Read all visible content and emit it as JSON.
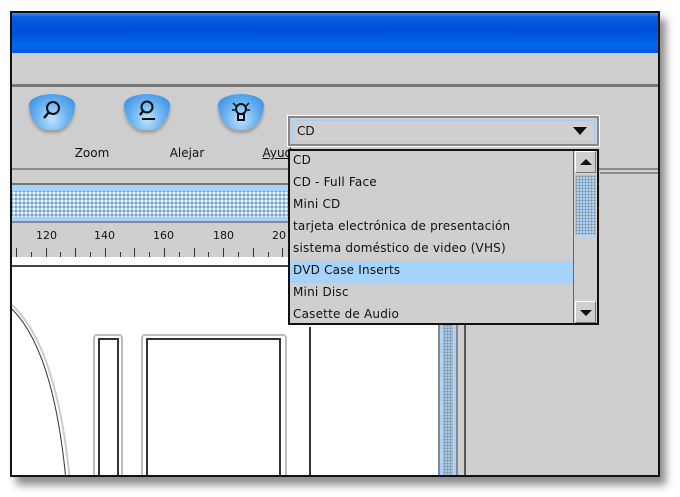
{
  "toolbar": {
    "items": [
      {
        "label": "Zoom",
        "icon": "zoom-in-icon"
      },
      {
        "label": "Alejar",
        "icon": "zoom-out-icon"
      },
      {
        "label": "Ayuda",
        "icon": "help-bulb-icon"
      }
    ]
  },
  "ruler": {
    "labels": [
      "120",
      "140",
      "160",
      "180",
      "20"
    ]
  },
  "combo": {
    "selected": "CD",
    "options": [
      "CD",
      "CD - Full Face",
      "Mini CD",
      "tarjeta electrónica de presentación",
      "sistema doméstico de video (VHS)",
      "DVD Case Inserts",
      "Mini Disc",
      "Casette de Audio"
    ],
    "highlighted_index": 5
  },
  "colors": {
    "title": "#0058e0",
    "highlight": "#a6d3fb",
    "panel": "#cfcfcf"
  }
}
